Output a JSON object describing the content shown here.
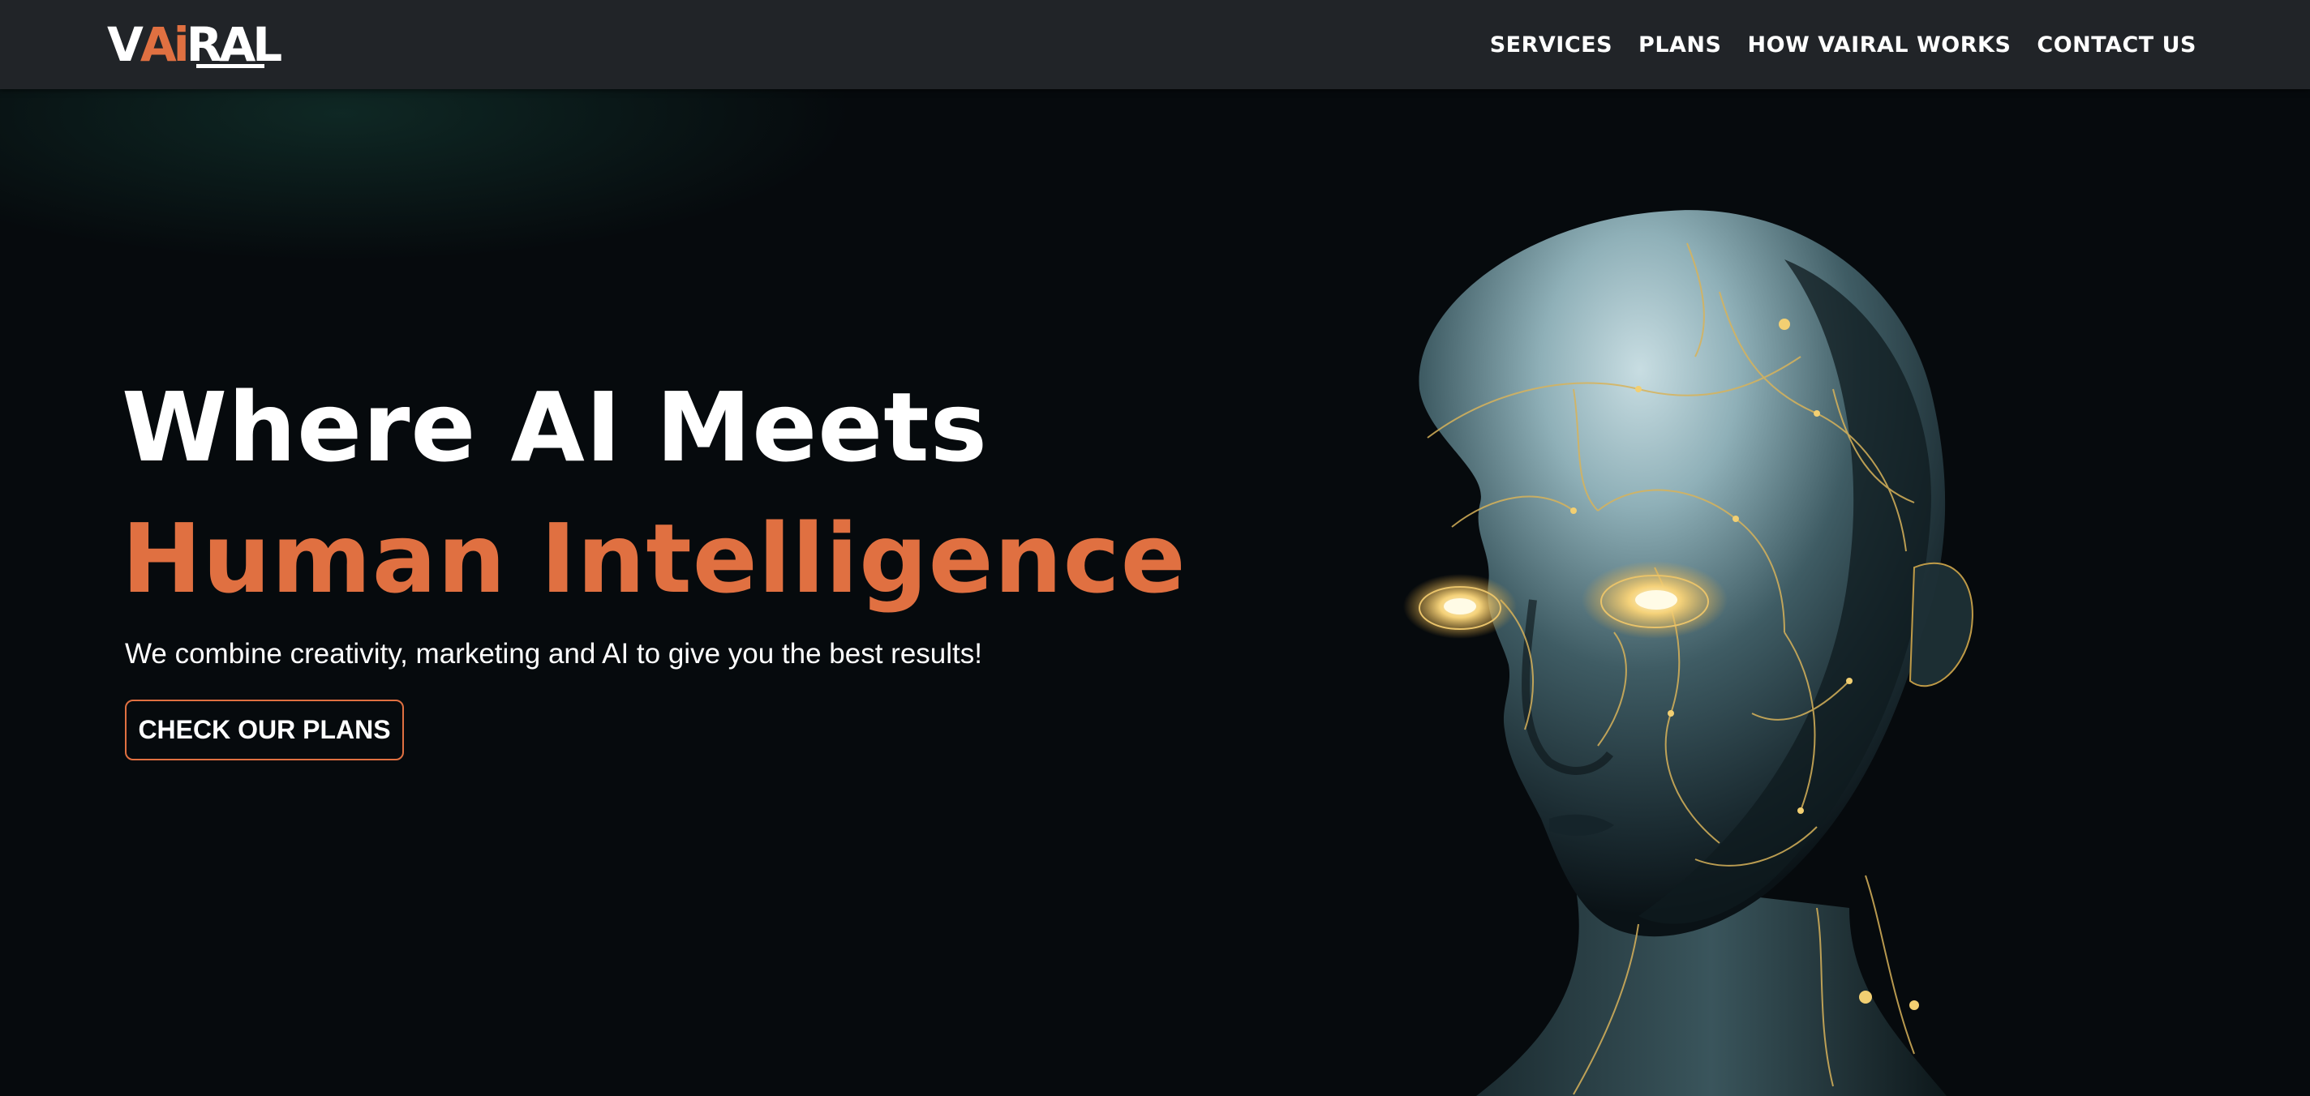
{
  "brand": {
    "logo_part_1": "V",
    "logo_part_2": "Ai",
    "logo_part_3": "RAL",
    "accent_color": "#e07041"
  },
  "nav": {
    "items": [
      {
        "label": "SERVICES"
      },
      {
        "label": "PLANS"
      },
      {
        "label": "HOW VAIRAL WORKS"
      },
      {
        "label": "CONTACT US"
      }
    ]
  },
  "hero": {
    "title_line_1": "Where AI Meets",
    "title_line_2": "Human Intelligence",
    "subtitle": "We combine creativity, marketing and AI to give you the best results!",
    "cta_label": "CHECK OUR PLANS",
    "image": "ai-robot-head-illustration"
  }
}
